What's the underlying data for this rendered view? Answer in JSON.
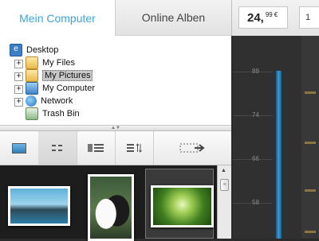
{
  "tabs": [
    {
      "label": "Mein Computer",
      "active": true
    },
    {
      "label": "Online Alben",
      "active": false
    }
  ],
  "tree": {
    "items": [
      {
        "label": "Desktop",
        "icon": "desktop-icon"
      },
      {
        "label": "My Files",
        "icon": "folder-icon"
      },
      {
        "label": "My Pictures",
        "icon": "folder-icon",
        "selected": true
      },
      {
        "label": "My Computer",
        "icon": "computer-icon"
      },
      {
        "label": "Network",
        "icon": "network-icon"
      },
      {
        "label": "Trash Bin",
        "icon": "trash-icon"
      }
    ]
  },
  "toolbar": {
    "buttons": [
      "single-view-icon",
      "grid-view-icon",
      "list-view-icon",
      "sort-icon",
      "export-icon"
    ]
  },
  "price": {
    "integer": "24,",
    "cents": "99",
    "currency": "€",
    "second": "1"
  },
  "chart": {
    "ticks": [
      "88",
      "74",
      "66",
      "58"
    ]
  },
  "colors": {
    "accent": "#3ba5d8",
    "panel_dark": "#2a2a2a",
    "bar_blue": "#2d7fb3"
  }
}
